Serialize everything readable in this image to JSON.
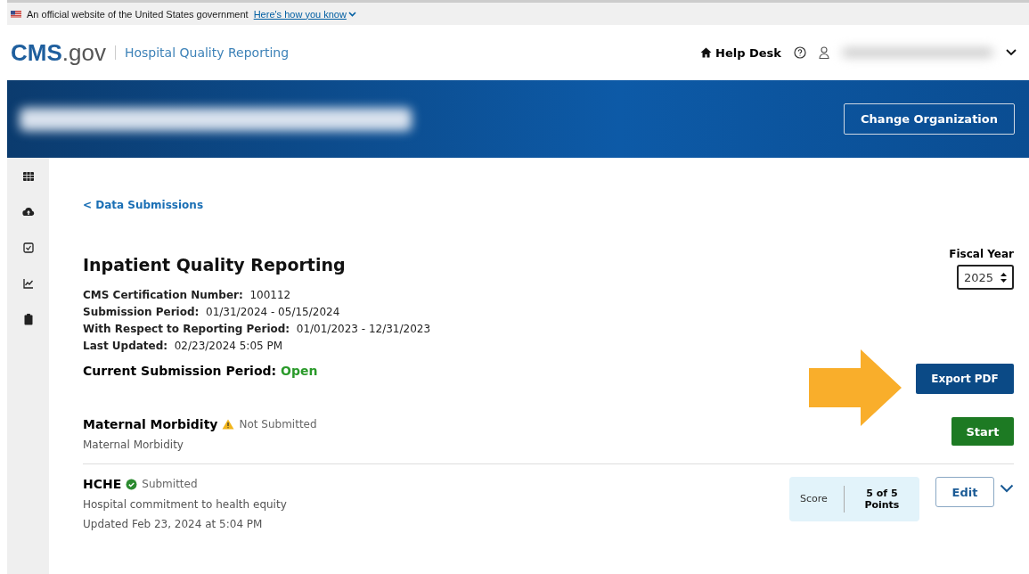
{
  "gov_banner": {
    "text": "An official website of the United States government",
    "link": "Here's how you know"
  },
  "header": {
    "logo_main": "CMS",
    "logo_suffix": ".gov",
    "product": "Hospital Quality Reporting",
    "help_desk": "Help Desk"
  },
  "org_banner": {
    "button": "Change Organization"
  },
  "sidebar": {
    "items": [
      {
        "kind": "grid",
        "selected": false
      },
      {
        "kind": "cloud",
        "selected": false
      },
      {
        "kind": "check",
        "selected": false
      },
      {
        "kind": "chart",
        "selected": false
      },
      {
        "kind": "clipboard",
        "selected": false
      }
    ]
  },
  "breadcrumb": "< Data Submissions",
  "program": {
    "title": "Inpatient Quality Reporting",
    "details": [
      {
        "label": "CMS Certification Number:",
        "value": "100112"
      },
      {
        "label": "Submission Period:",
        "value": "01/31/2024 - 05/15/2024"
      },
      {
        "label": "With Respect to Reporting Period:",
        "value": "01/01/2023 - 12/31/2023"
      },
      {
        "label": "Last Updated:",
        "value": "02/23/2024 5:05 PM"
      }
    ],
    "period_label": "Current Submission Period:",
    "period_status": "Open"
  },
  "fiscal_year": {
    "label": "Fiscal Year",
    "value": "2025"
  },
  "export_button": "Export PDF",
  "submissions": [
    {
      "kind": "start",
      "name": "Maternal Morbidity",
      "status": {
        "kind": "warning",
        "text": "Not Submitted"
      },
      "description": "Maternal Morbidity",
      "action": "Start"
    },
    {
      "kind": "scored",
      "name": "HCHE",
      "status": {
        "kind": "submitted",
        "text": "Submitted"
      },
      "description": "Hospital commitment to health equity",
      "updated": "Updated Feb 23, 2024 at 5:04 PM",
      "score_label": "Score",
      "score_value": "5 of 5 Points",
      "action": "Edit",
      "expanded": false
    }
  ]
}
